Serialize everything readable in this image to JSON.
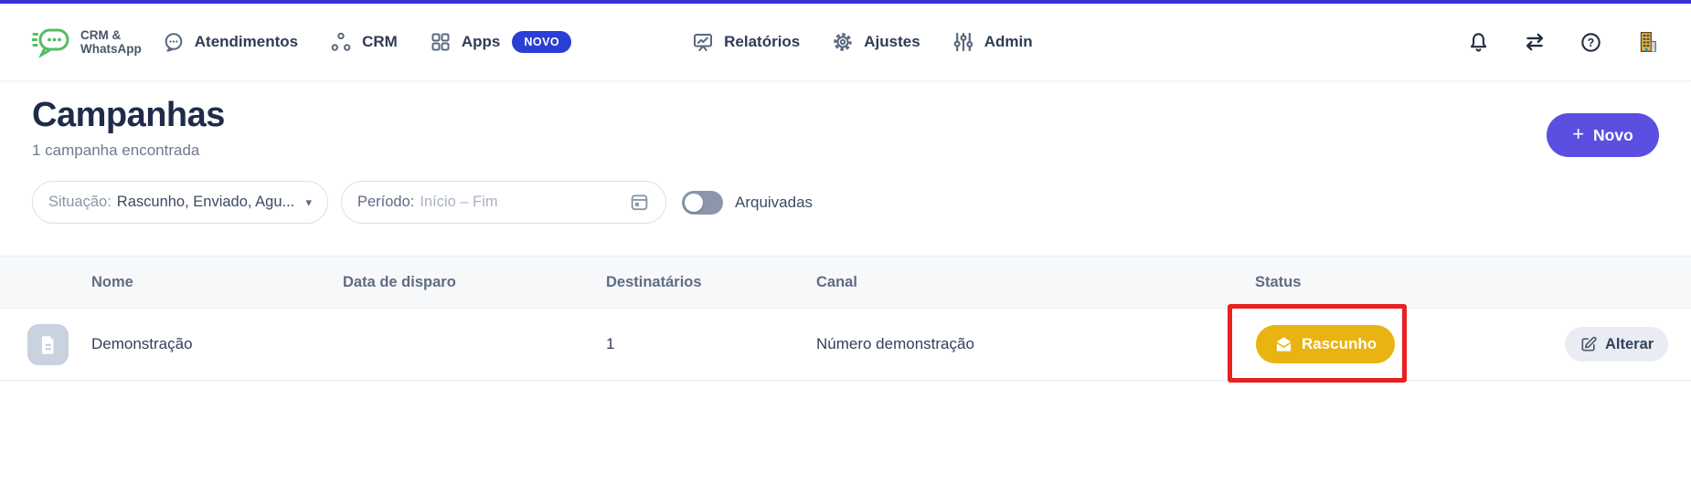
{
  "navbar": {
    "logo": {
      "line1": "CRM &",
      "line2": "WhatsApp"
    },
    "items": [
      {
        "label": "Atendimentos"
      },
      {
        "label": "CRM"
      },
      {
        "label": "Apps",
        "badge": "NOVO"
      },
      {
        "label": "Relatórios"
      },
      {
        "label": "Ajustes"
      },
      {
        "label": "Admin"
      }
    ],
    "right_icons": [
      "bell-icon",
      "transfer-icon",
      "help-icon",
      "company-icon"
    ]
  },
  "header": {
    "title": "Campanhas",
    "subtitle": "1 campanha encontrada",
    "new_button_label": "Novo"
  },
  "filters": {
    "situacao_label": "Situação:",
    "situacao_value": "Rascunho, Enviado, Agu...",
    "periodo_label": "Período:",
    "periodo_placeholder": "Início – Fim",
    "arquivadas_label": "Arquivadas",
    "arquivadas_on": false
  },
  "table": {
    "columns": {
      "nome": "Nome",
      "data_disparo": "Data de disparo",
      "destinatarios": "Destinatários",
      "canal": "Canal",
      "status": "Status"
    },
    "rows": [
      {
        "nome": "Demonstração",
        "data_disparo": "",
        "destinatarios": "1",
        "canal": "Número demonstração",
        "status": "Rascunho",
        "action_label": "Alterar"
      }
    ]
  },
  "icons": {
    "plus": "+",
    "caret_down": "▾",
    "question": "?"
  },
  "colors": {
    "accent_purple": "#5a4fe0",
    "nav_badge_blue": "#2b3fd6",
    "status_yellow": "#e9b312",
    "annotation_red": "#e8201f",
    "logo_green": "#53bd63"
  }
}
